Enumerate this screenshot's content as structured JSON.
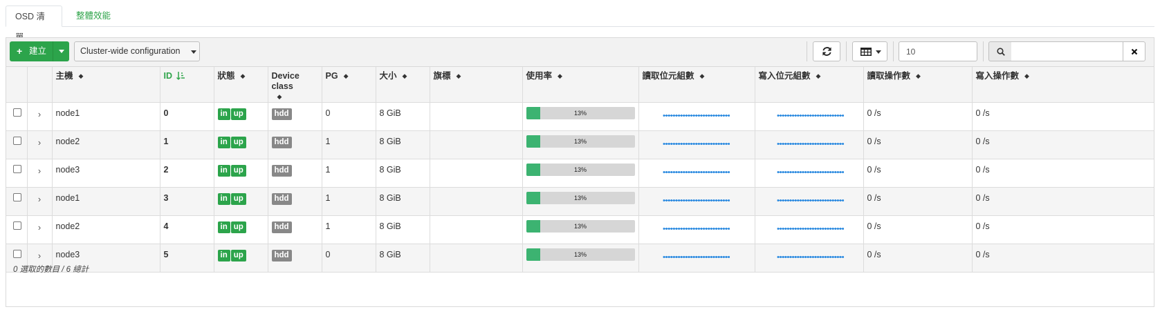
{
  "tabs": [
    {
      "label": "OSD 清單",
      "active": true
    },
    {
      "label": "整體效能",
      "active": false
    }
  ],
  "toolbar": {
    "create_label": "建立",
    "cluster_config_label": "Cluster-wide configuration",
    "page_size_value": "10",
    "search_placeholder": ""
  },
  "columns": [
    "主機",
    "ID",
    "狀態",
    "Device class",
    "PG",
    "大小",
    "旗標",
    "使用率",
    "讀取位元組數",
    "寫入位元組數",
    "讀取操作數",
    "寫入操作數"
  ],
  "sorted_column": "ID",
  "rows": [
    {
      "host": "node1",
      "id": "0",
      "status": [
        "in",
        "up"
      ],
      "device_class": "hdd",
      "pg": "0",
      "size": "8 GiB",
      "flags": "",
      "usage_percent": 13,
      "usage_label": "13%",
      "read_ops": "0 /s",
      "write_ops": "0 /s"
    },
    {
      "host": "node2",
      "id": "1",
      "status": [
        "in",
        "up"
      ],
      "device_class": "hdd",
      "pg": "1",
      "size": "8 GiB",
      "flags": "",
      "usage_percent": 13,
      "usage_label": "13%",
      "read_ops": "0 /s",
      "write_ops": "0 /s"
    },
    {
      "host": "node3",
      "id": "2",
      "status": [
        "in",
        "up"
      ],
      "device_class": "hdd",
      "pg": "1",
      "size": "8 GiB",
      "flags": "",
      "usage_percent": 13,
      "usage_label": "13%",
      "read_ops": "0 /s",
      "write_ops": "0 /s"
    },
    {
      "host": "node1",
      "id": "3",
      "status": [
        "in",
        "up"
      ],
      "device_class": "hdd",
      "pg": "1",
      "size": "8 GiB",
      "flags": "",
      "usage_percent": 13,
      "usage_label": "13%",
      "read_ops": "0 /s",
      "write_ops": "0 /s"
    },
    {
      "host": "node2",
      "id": "4",
      "status": [
        "in",
        "up"
      ],
      "device_class": "hdd",
      "pg": "1",
      "size": "8 GiB",
      "flags": "",
      "usage_percent": 13,
      "usage_label": "13%",
      "read_ops": "0 /s",
      "write_ops": "0 /s"
    },
    {
      "host": "node3",
      "id": "5",
      "status": [
        "in",
        "up"
      ],
      "device_class": "hdd",
      "pg": "0",
      "size": "8 GiB",
      "flags": "",
      "usage_percent": 13,
      "usage_label": "13%",
      "read_ops": "0 /s",
      "write_ops": "0 /s"
    }
  ],
  "footer": {
    "summary": "0 選取的數目 / 6 總計"
  },
  "colors": {
    "accent_green": "#2ca44b",
    "usage_fill": "#3cb371",
    "usage_track": "#d6d6d6",
    "sparkline": "#2b8ae0",
    "badge_gray": "#888888"
  }
}
